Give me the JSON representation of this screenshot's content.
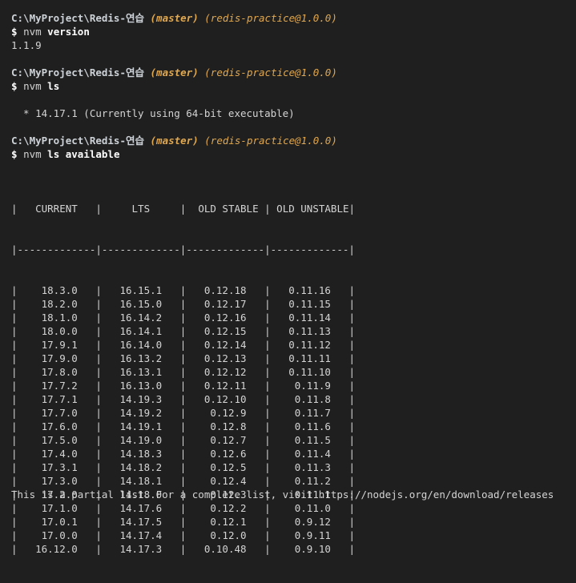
{
  "prompts": [
    {
      "path": "C:\\MyProject\\Redis-연습",
      "branch": "(master)",
      "package": "(redis-practice@1.0.0)",
      "dollar": "$",
      "command": "nvm",
      "args": "version"
    },
    {
      "path": "C:\\MyProject\\Redis-연습",
      "branch": "(master)",
      "package": "(redis-practice@1.0.0)",
      "dollar": "$",
      "command": "nvm",
      "args": "ls"
    },
    {
      "path": "C:\\MyProject\\Redis-연습",
      "branch": "(master)",
      "package": "(redis-practice@1.0.0)",
      "dollar": "$",
      "command": "nvm",
      "args": "ls available"
    }
  ],
  "outputs": {
    "version": "1.1.9",
    "ls": "  * 14.17.1 (Currently using 64-bit executable)",
    "footer": "This is a partial list. For a complete list, visit https://nodejs.org/en/download/releases"
  },
  "table": {
    "headers": [
      "CURRENT",
      "LTS",
      "OLD STABLE",
      "OLD UNSTABLE"
    ],
    "rows": [
      [
        "18.3.0",
        "16.15.1",
        "0.12.18",
        "0.11.16"
      ],
      [
        "18.2.0",
        "16.15.0",
        "0.12.17",
        "0.11.15"
      ],
      [
        "18.1.0",
        "16.14.2",
        "0.12.16",
        "0.11.14"
      ],
      [
        "18.0.0",
        "16.14.1",
        "0.12.15",
        "0.11.13"
      ],
      [
        "17.9.1",
        "16.14.0",
        "0.12.14",
        "0.11.12"
      ],
      [
        "17.9.0",
        "16.13.2",
        "0.12.13",
        "0.11.11"
      ],
      [
        "17.8.0",
        "16.13.1",
        "0.12.12",
        "0.11.10"
      ],
      [
        "17.7.2",
        "16.13.0",
        "0.12.11",
        "0.11.9"
      ],
      [
        "17.7.1",
        "14.19.3",
        "0.12.10",
        "0.11.8"
      ],
      [
        "17.7.0",
        "14.19.2",
        "0.12.9",
        "0.11.7"
      ],
      [
        "17.6.0",
        "14.19.1",
        "0.12.8",
        "0.11.6"
      ],
      [
        "17.5.0",
        "14.19.0",
        "0.12.7",
        "0.11.5"
      ],
      [
        "17.4.0",
        "14.18.3",
        "0.12.6",
        "0.11.4"
      ],
      [
        "17.3.1",
        "14.18.2",
        "0.12.5",
        "0.11.3"
      ],
      [
        "17.3.0",
        "14.18.1",
        "0.12.4",
        "0.11.2"
      ],
      [
        "17.2.0",
        "14.18.0",
        "0.12.3",
        "0.11.1"
      ],
      [
        "17.1.0",
        "14.17.6",
        "0.12.2",
        "0.11.0"
      ],
      [
        "17.0.1",
        "14.17.5",
        "0.12.1",
        "0.9.12"
      ],
      [
        "17.0.0",
        "14.17.4",
        "0.12.0",
        "0.9.11"
      ],
      [
        "16.12.0",
        "14.17.3",
        "0.10.48",
        "0.9.10"
      ]
    ]
  }
}
